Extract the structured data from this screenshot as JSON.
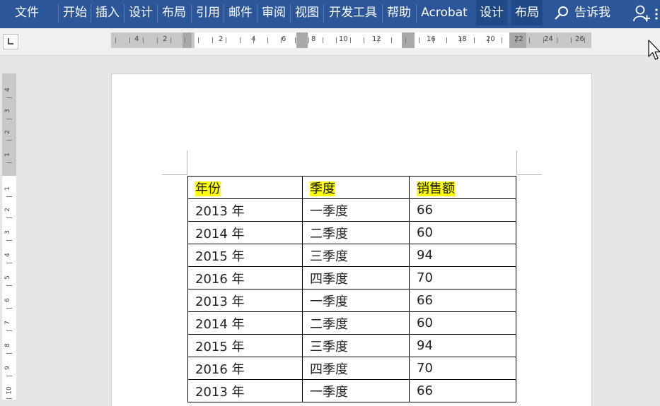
{
  "ribbon": {
    "tabs": [
      {
        "label": "文件",
        "name": "tab-file",
        "contextual": false
      },
      {
        "label": "开始",
        "name": "tab-home",
        "contextual": false
      },
      {
        "label": "插入",
        "name": "tab-insert",
        "contextual": false
      },
      {
        "label": "设计",
        "name": "tab-design",
        "contextual": false
      },
      {
        "label": "布局",
        "name": "tab-layout",
        "contextual": false
      },
      {
        "label": "引用",
        "name": "tab-references",
        "contextual": false
      },
      {
        "label": "邮件",
        "name": "tab-mailings",
        "contextual": false
      },
      {
        "label": "审阅",
        "name": "tab-review",
        "contextual": false
      },
      {
        "label": "视图",
        "name": "tab-view",
        "contextual": false
      },
      {
        "label": "开发工具",
        "name": "tab-developer",
        "contextual": false
      },
      {
        "label": "帮助",
        "name": "tab-help",
        "contextual": false
      },
      {
        "label": "Acrobat",
        "name": "tab-acrobat",
        "contextual": false
      },
      {
        "label": "设计",
        "name": "tab-table-design",
        "contextual": true
      },
      {
        "label": "布局",
        "name": "tab-table-layout",
        "contextual": true
      }
    ],
    "tell_me": "告诉我",
    "accent_color": "#2b579a"
  },
  "ruler": {
    "horizontal_labels": [
      "4",
      "2",
      "2",
      "4",
      "6",
      "8",
      "10",
      "12",
      "16",
      "18",
      "20",
      "22",
      "24",
      "26"
    ],
    "vertical_labels": [
      "4",
      "3",
      "2",
      "1",
      "1",
      "2",
      "3",
      "4",
      "5",
      "6",
      "7",
      "8",
      "9",
      "10"
    ]
  },
  "table": {
    "headers": [
      "年份",
      "季度",
      "销售额"
    ],
    "header_highlight": "#ffff00",
    "rows": [
      [
        "2013 年",
        "一季度",
        "66"
      ],
      [
        "2014 年",
        "二季度",
        "60"
      ],
      [
        "2015 年",
        "三季度",
        "94"
      ],
      [
        "2016 年",
        "四季度",
        "70"
      ],
      [
        "2013 年",
        "一季度",
        "66"
      ],
      [
        "2014 年",
        "二季度",
        "60"
      ],
      [
        "2015 年",
        "三季度",
        "94"
      ],
      [
        "2016 年",
        "四季度",
        "70"
      ],
      [
        "2013 年",
        "一季度",
        "66"
      ]
    ]
  }
}
